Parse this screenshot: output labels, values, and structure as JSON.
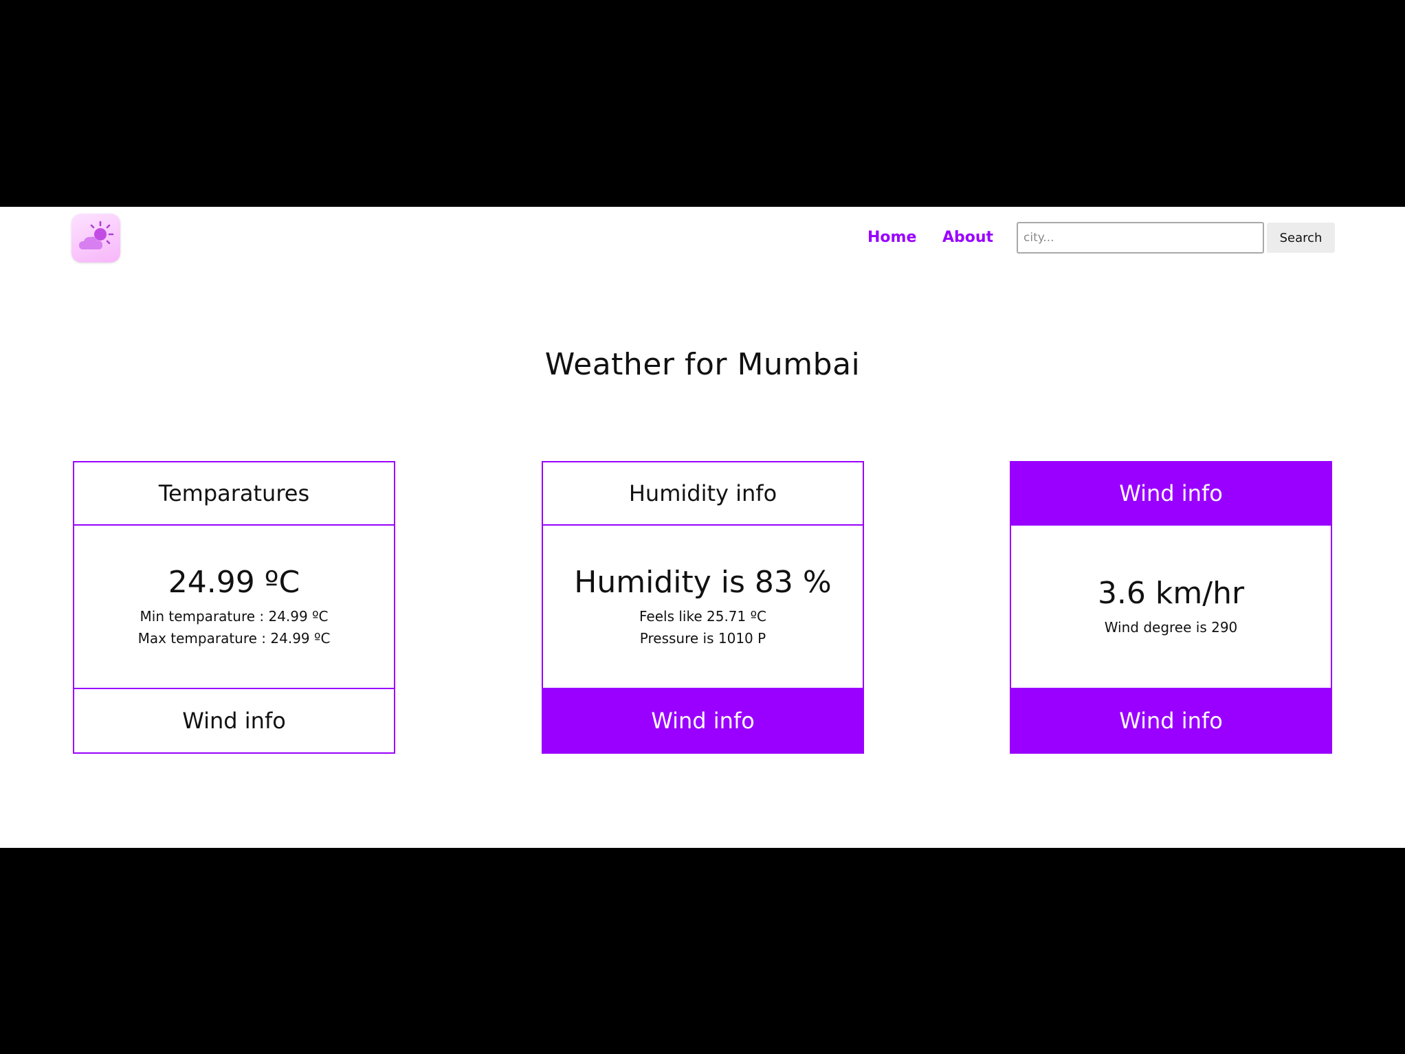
{
  "navbar": {
    "logo_icon": "weather-sun-cloud-icon",
    "links": [
      {
        "label": "Home"
      },
      {
        "label": "About"
      }
    ],
    "search": {
      "placeholder": "city...",
      "value": "",
      "button_label": "Search"
    },
    "accent_color": "#9900ff"
  },
  "main": {
    "title": "Weather for Mumbai",
    "cards": [
      {
        "header": "Temparatures",
        "value": "24.99 ºC",
        "details": [
          "Min temparature : 24.99 ºC",
          "Max temparature : 24.99 ºC"
        ],
        "footer": "Wind info"
      },
      {
        "header": "Humidity info",
        "value": "Humidity is 83 %",
        "details": [
          "Feels like 25.71 ºC",
          "Pressure is 1010 P"
        ],
        "footer": "Wind info"
      },
      {
        "header": "Wind info",
        "value": "3.6 km/hr",
        "details": [
          "Wind degree is 290"
        ],
        "footer": "Wind info"
      }
    ]
  }
}
